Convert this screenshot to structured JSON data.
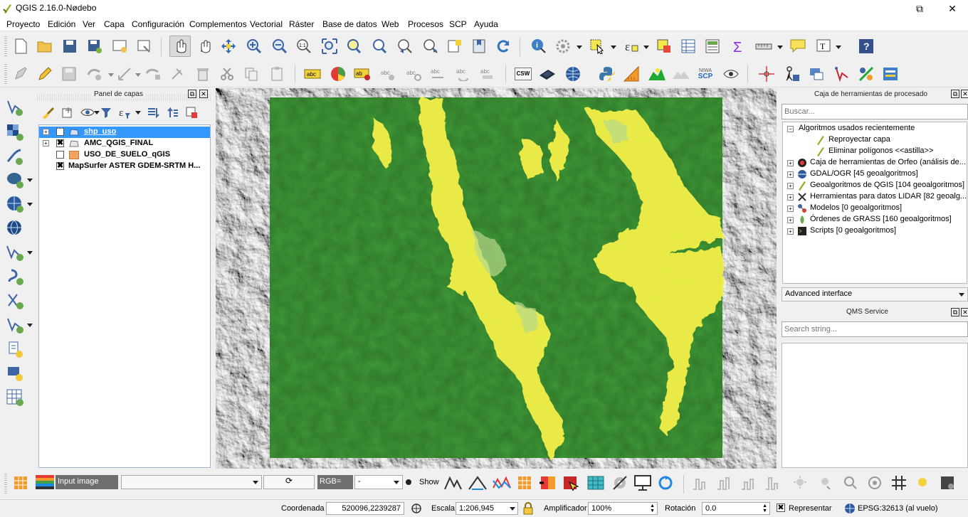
{
  "window": {
    "title": "QGIS 2.16.0-Nødebo",
    "restore_glyph": "⧉",
    "close_glyph": "✕"
  },
  "menu": [
    "Proyecto",
    "Edición",
    "Ver",
    "Capa",
    "Configuración",
    "Complementos",
    "Vectorial",
    "Ráster",
    "Base de datos",
    "Web",
    "Procesos",
    "SCP",
    "Ayuda"
  ],
  "toolbar2": {
    "csw": "CSW",
    "niwa": "NIWA",
    "scp": "SCP"
  },
  "layers_panel": {
    "title": "Panel de capas",
    "layers": [
      {
        "name": "shp_uso",
        "expander": "+",
        "checked": "✖"
      },
      {
        "name": "AMC_QGIS_FINAL",
        "expander": "+",
        "checked": "✖"
      },
      {
        "name": "USO_DE_SUELO_qGIS",
        "expander": "",
        "checked": ""
      },
      {
        "name": "MapSurfer ASTER GDEM-SRTM H...",
        "expander": "",
        "checked": "✖"
      }
    ]
  },
  "processing": {
    "title": "Caja de herramientas de procesado",
    "search_placeholder": "Buscar...",
    "tree": [
      {
        "label": "Algoritmos usados recientemente",
        "expander": "−"
      },
      {
        "label": "Reproyectar capa"
      },
      {
        "label": "Eliminar polígonos <<astilla>>"
      },
      {
        "label": "Caja de herramientas de Orfeo (análisis de...",
        "expander": "+"
      },
      {
        "label": "GDAL/OGR [45 geoalgoritmos]",
        "expander": "+"
      },
      {
        "label": "Geoalgoritmos de QGIS [104 geoalgoritmos]",
        "expander": "+"
      },
      {
        "label": "Herramientas para datos LIDAR [82 geoalg...",
        "expander": "+"
      },
      {
        "label": "Modelos [0 geoalgoritmos]",
        "expander": "+"
      },
      {
        "label": "Órdenes de GRASS [160 geoalgoritmos]",
        "expander": "+"
      },
      {
        "label": "Scripts [0 geoalgoritmos]",
        "expander": "+"
      }
    ],
    "interface_select": "Advanced interface"
  },
  "qms": {
    "title": "QMS Service",
    "search_placeholder": "Search string..."
  },
  "scp": {
    "input_label": "Input image",
    "rgb_label": "RGB=",
    "rgb_value": "-",
    "show_label": "Show",
    "refresh_glyph": "⟳"
  },
  "status": {
    "coord_label": "Coordenada",
    "coord_value": "520096,2239287",
    "scale_label": "Escala",
    "scale_value": "1:206,945",
    "magnifier_label": "Amplificador",
    "magnifier_value": "100%",
    "rotation_label": "Rotación",
    "rotation_value": "0.0",
    "render_label": "Representar",
    "render_checked": "✖",
    "crs_label": "EPSG:32613 (al vuelo)"
  },
  "colors": {
    "accent": "#3399ff",
    "map_green": "#3e9a35",
    "map_yellow": "#f3f04a"
  }
}
